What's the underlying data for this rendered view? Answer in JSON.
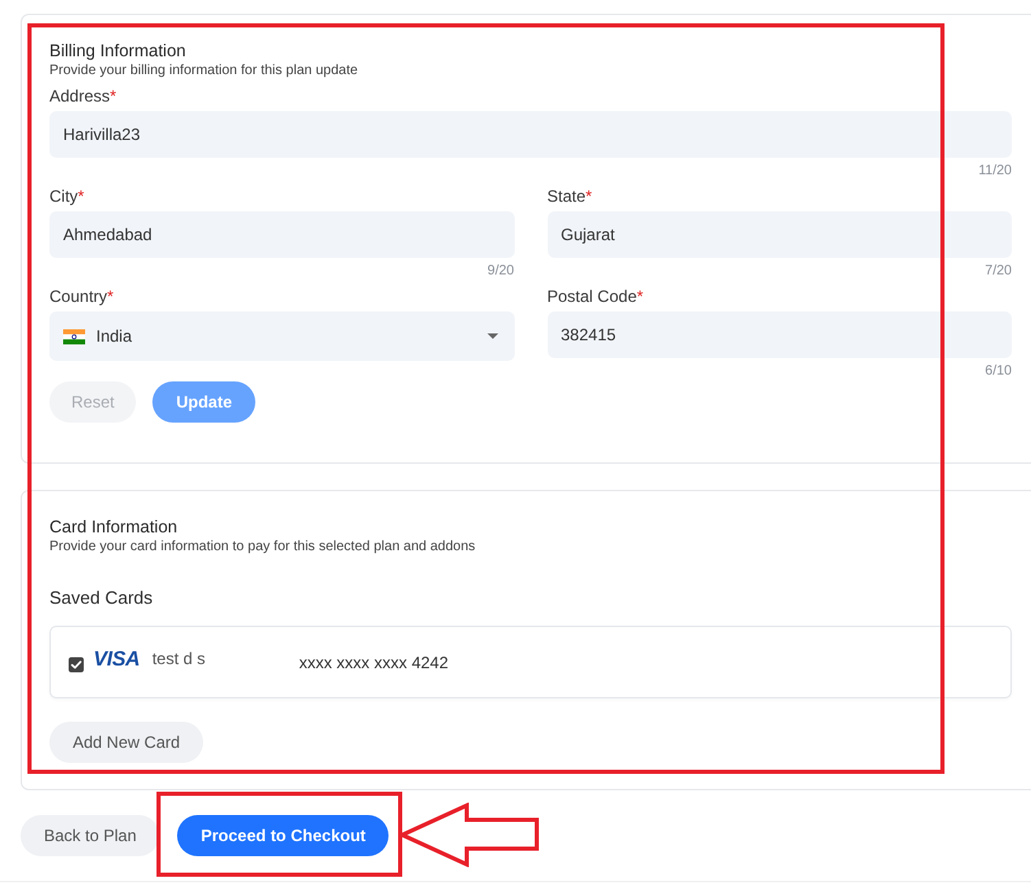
{
  "billing": {
    "title": "Billing Information",
    "subtitle": "Provide your billing information for this plan update",
    "rows": [
      {
        "fields": [
          {
            "kind": "text",
            "label": "Address",
            "required_mark": "*",
            "value": "Harivilla23",
            "counter": "11/20"
          }
        ]
      },
      {
        "fields": [
          {
            "kind": "text",
            "label": "City",
            "required_mark": "*",
            "value": "Ahmedabad",
            "counter": "9/20"
          },
          {
            "kind": "text",
            "label": "State",
            "required_mark": "*",
            "value": "Gujarat",
            "counter": "7/20"
          }
        ]
      },
      {
        "fields": [
          {
            "kind": "select",
            "label": "Country",
            "required_mark": "*",
            "value": "India"
          },
          {
            "kind": "text",
            "label": "Postal Code",
            "required_mark": "*",
            "value": "382415",
            "counter": "6/10"
          }
        ]
      }
    ],
    "buttons": [
      {
        "kind": "secondary",
        "label": "Reset",
        "disabled": true
      },
      {
        "kind": "primary",
        "label": "Update",
        "disabled": true
      }
    ]
  },
  "card_info": {
    "title": "Card Information",
    "subtitle": "Provide your card information to pay for this selected plan and addons",
    "saved_cards_heading": "Saved Cards",
    "saved_cards": [
      {
        "checked": true,
        "brand": "VISA",
        "holder": "test d s",
        "number": "xxxx xxxx xxxx 4242"
      }
    ],
    "add_button": "Add New Card"
  },
  "footer_buttons": [
    {
      "kind": "secondary",
      "label": "Back to Plan",
      "disabled": false
    },
    {
      "kind": "primary",
      "label": "Proceed to Checkout",
      "disabled": false
    }
  ]
}
